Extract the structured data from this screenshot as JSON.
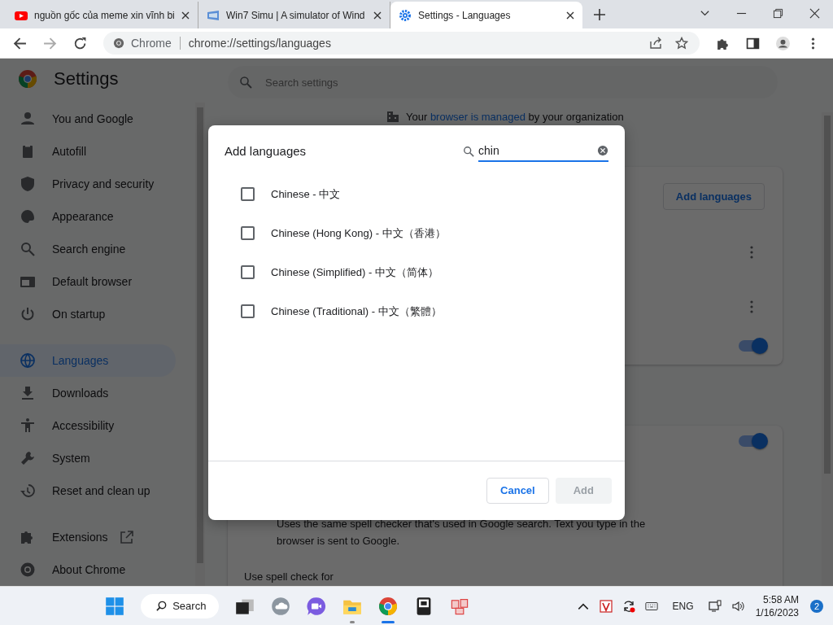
{
  "tabs": [
    {
      "title": "nguồn gốc của meme xin vĩnh bi",
      "selected": false
    },
    {
      "title": "Win7 Simu | A simulator of Wind",
      "selected": false
    },
    {
      "title": "Settings - Languages",
      "selected": true
    }
  ],
  "address": {
    "chip": "Chrome",
    "url": "chrome://settings/languages"
  },
  "settings": {
    "title": "Settings",
    "search_placeholder": "Search settings",
    "sidebar": [
      {
        "label": "You and Google",
        "selected": false
      },
      {
        "label": "Autofill",
        "selected": false
      },
      {
        "label": "Privacy and security",
        "selected": false
      },
      {
        "label": "Appearance",
        "selected": false
      },
      {
        "label": "Search engine",
        "selected": false
      },
      {
        "label": "Default browser",
        "selected": false
      },
      {
        "label": "On startup",
        "selected": false
      },
      {
        "label": "Languages",
        "selected": true
      },
      {
        "label": "Downloads",
        "selected": false
      },
      {
        "label": "Accessibility",
        "selected": false
      },
      {
        "label": "System",
        "selected": false
      },
      {
        "label": "Reset and clean up",
        "selected": false
      },
      {
        "label": "Extensions",
        "selected": false
      },
      {
        "label": "About Chrome",
        "selected": false
      }
    ],
    "managed_notice": {
      "before": "Your ",
      "link": "browser is managed",
      "after": " by your organization"
    },
    "languages_card": {
      "add_button": "Add languages",
      "toggle_on": true
    },
    "spell_card": {
      "toggle_on": true,
      "description": "Uses the same spell checker that's used in Google search. Text you type in the browser is sent to Google.",
      "use_spell_check_label": "Use spell check for"
    }
  },
  "dialog": {
    "title": "Add languages",
    "search_value": "chin",
    "options": [
      {
        "label": "Chinese - 中文",
        "checked": false
      },
      {
        "label": "Chinese (Hong Kong) - 中文（香港）",
        "checked": false
      },
      {
        "label": "Chinese (Simplified) - 中文（简体）",
        "checked": false
      },
      {
        "label": "Chinese (Traditional) - 中文（繁體）",
        "checked": false
      }
    ],
    "cancel": "Cancel",
    "add": {
      "label": "Add",
      "disabled": true
    }
  },
  "taskbar": {
    "search": "Search",
    "language": "ENG",
    "time": "5:58 AM",
    "date": "1/16/2023",
    "notifications": "2"
  }
}
